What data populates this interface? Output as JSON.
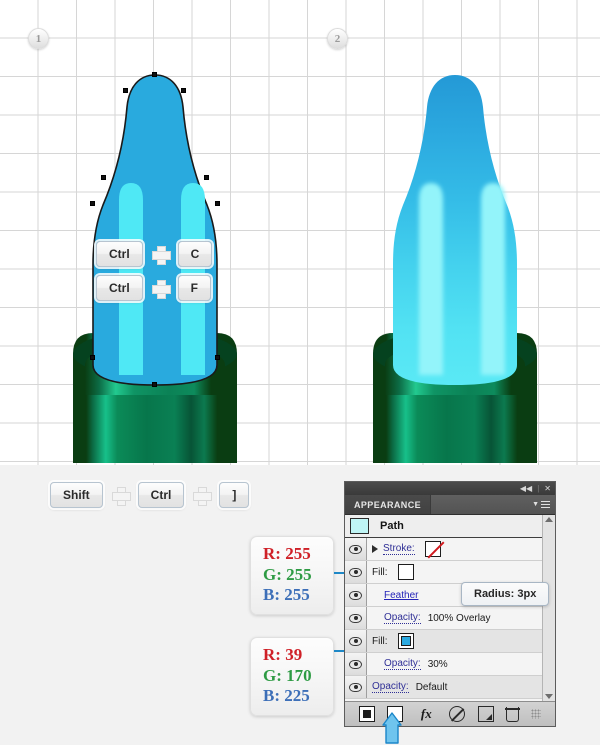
{
  "steps": [
    {
      "number": "1"
    },
    {
      "number": "2"
    }
  ],
  "shortcuts": {
    "copy": {
      "keys": [
        "Ctrl",
        "C"
      ],
      "separator": "plus-icon"
    },
    "paste_in_front": {
      "keys": [
        "Ctrl",
        "F"
      ],
      "separator": "plus-icon"
    },
    "bring_forward": {
      "keys": [
        "Shift",
        "Ctrl",
        "]"
      ],
      "separator": "plus-icon"
    }
  },
  "color_callouts": [
    {
      "id": "white",
      "r_label": "R: 255",
      "g_label": "G: 255",
      "b_label": "B: 255",
      "hex": "#FFFFFF"
    },
    {
      "id": "blue",
      "r_label": "R: 39",
      "g_label": "G: 170",
      "b_label": "B: 225",
      "hex": "#27AAE1"
    }
  ],
  "callout_colors": {
    "r_text": "#CF2027",
    "g_text": "#2E9B44",
    "b_text": "#3D6FB8",
    "leader_line": "#1E88C7"
  },
  "panel": {
    "titlebar": {
      "collapse_icon": "collapse-arrows-icon",
      "collapse_glyph": "◀◀",
      "separator": "|",
      "close_icon": "close-icon",
      "close_glyph": "✕"
    },
    "tab_label": "APPEARANCE",
    "menu_icon": "panel-menu-icon",
    "target": {
      "swatch_color": "#BFF5F5",
      "label": "Path"
    },
    "rows": [
      {
        "id": "stroke",
        "visible": true,
        "disclosure": true,
        "label": "Stroke:",
        "label_style": "dotted-link",
        "swatch": "none",
        "value": "",
        "indent": false,
        "highlight": false
      },
      {
        "id": "fill-white",
        "visible": true,
        "disclosure": false,
        "label": "Fill:",
        "label_style": "plain",
        "swatch": "white",
        "value": "",
        "indent": false,
        "highlight": false
      },
      {
        "id": "feather",
        "visible": true,
        "disclosure": false,
        "label": "Feather",
        "label_style": "link",
        "swatch": "",
        "value": "",
        "indent": true,
        "highlight": false
      },
      {
        "id": "opacity-overlay",
        "visible": true,
        "disclosure": false,
        "label": "Opacity:",
        "label_style": "dotted-link",
        "swatch": "",
        "value": "100% Overlay",
        "indent": true,
        "highlight": false
      },
      {
        "id": "fill-blue",
        "visible": true,
        "disclosure": false,
        "label": "Fill:",
        "label_style": "plain",
        "swatch": "blue",
        "value": "",
        "indent": false,
        "highlight": true
      },
      {
        "id": "opacity-30",
        "visible": true,
        "disclosure": false,
        "label": "Opacity:",
        "label_style": "dotted-link",
        "swatch": "",
        "value": "30%",
        "indent": true,
        "highlight": false
      },
      {
        "id": "opacity-default",
        "visible": true,
        "disclosure": false,
        "label": "Opacity:",
        "label_style": "dotted-link",
        "swatch": "",
        "value": "Default",
        "indent": false,
        "highlight": true
      }
    ],
    "footer_buttons": [
      {
        "id": "add-new-stroke",
        "icon": "add-new-stroke-icon"
      },
      {
        "id": "add-new-fill",
        "icon": "add-new-fill-icon"
      },
      {
        "id": "add-new-effect",
        "icon": "fx-icon",
        "glyph": "fx"
      },
      {
        "id": "clear-appearance",
        "icon": "clear-appearance-icon"
      },
      {
        "id": "duplicate-item",
        "icon": "duplicate-icon"
      },
      {
        "id": "delete-item",
        "icon": "trash-icon"
      }
    ],
    "scrollbar": {
      "up_icon": "scroll-up-icon",
      "down_icon": "scroll-down-icon"
    }
  },
  "tooltip": {
    "label": "Radius: 3px"
  },
  "cursor": {
    "icon": "arrow-cursor-icon",
    "color": "#2B9FE0"
  },
  "artwork": {
    "left": {
      "state": "selected-flat-fill",
      "tip_color": "#29AADE",
      "stripe_color": "#4FE8F5",
      "outline_color": "#1a1a1a",
      "body_dark": "#0A3D12",
      "body_mid": "#067A4E",
      "body_light": "#17C08A"
    },
    "right": {
      "state": "gradient-feathered",
      "tip_top_color": "#29AADE",
      "tip_bottom_color": "#5EE8F2",
      "stripe_color": "#8FF6FA",
      "body_dark": "#0A3D12",
      "body_mid": "#067A4E",
      "body_light": "#17C08A"
    }
  }
}
